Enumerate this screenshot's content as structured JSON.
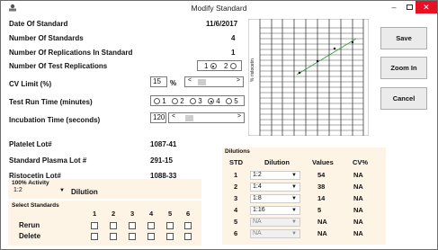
{
  "window": {
    "title": "Modify Standard"
  },
  "fields": {
    "date_label": "Date Of Standard",
    "date_value": "11/6/2017",
    "num_standards_label": "Number Of Standards",
    "num_standards_value": "4",
    "num_repl_std_label": "Number Of Replications In Standard",
    "num_repl_std_value": "1",
    "num_test_repl_label": "Number Of Test Replications",
    "test_repl_options": [
      "1",
      "2"
    ],
    "test_repl_selected": "1",
    "cv_label": "CV Limit (%)",
    "cv_value": "15",
    "cv_unit": "%",
    "run_time_label": "Test Run Time (minutes)",
    "run_time_options": [
      "1",
      "2",
      "3",
      "4",
      "5"
    ],
    "run_time_selected": "4",
    "incubation_label": "Incubation Time (seconds)",
    "incubation_value": "120",
    "platelet_label": "Platelet Lot#",
    "platelet_value": "1087-41",
    "plasma_label": "Standard Plasma Lot #",
    "plasma_value": "291-15",
    "ristocetin_label": "Ristocetin Lot#",
    "ristocetin_value": "1088-33"
  },
  "activity": {
    "label": "100% Activity",
    "value": "1:2",
    "dilution_label": "Dilution"
  },
  "select_standards": {
    "title": "Select Standards",
    "columns": [
      "1",
      "2",
      "3",
      "4",
      "5",
      "6"
    ],
    "rows": [
      "Rerun",
      "Delete"
    ]
  },
  "chart": {
    "ylabel": "% ristocetin"
  },
  "buttons": {
    "save": "Save",
    "zoom": "Zoom In",
    "cancel": "Cancel"
  },
  "dilutions": {
    "title": "Dilutions",
    "headers": [
      "STD",
      "Dilution",
      "Values",
      "CV%"
    ],
    "rows": [
      {
        "std": "1",
        "dilution": "1:2",
        "value": "54",
        "cv": "NA",
        "enabled": true
      },
      {
        "std": "2",
        "dilution": "1:4",
        "value": "38",
        "cv": "NA",
        "enabled": true
      },
      {
        "std": "3",
        "dilution": "1:8",
        "value": "14",
        "cv": "NA",
        "enabled": true
      },
      {
        "std": "4",
        "dilution": "1:16",
        "value": "5",
        "cv": "NA",
        "enabled": true
      },
      {
        "std": "5",
        "dilution": "NA",
        "value": "NA",
        "cv": "NA",
        "enabled": false
      },
      {
        "std": "6",
        "dilution": "NA",
        "value": "NA",
        "cv": "NA",
        "enabled": false
      }
    ]
  },
  "colors": {
    "close": "#e81123",
    "panel": "#fdf4e6",
    "trend": "#2e9e3a"
  }
}
